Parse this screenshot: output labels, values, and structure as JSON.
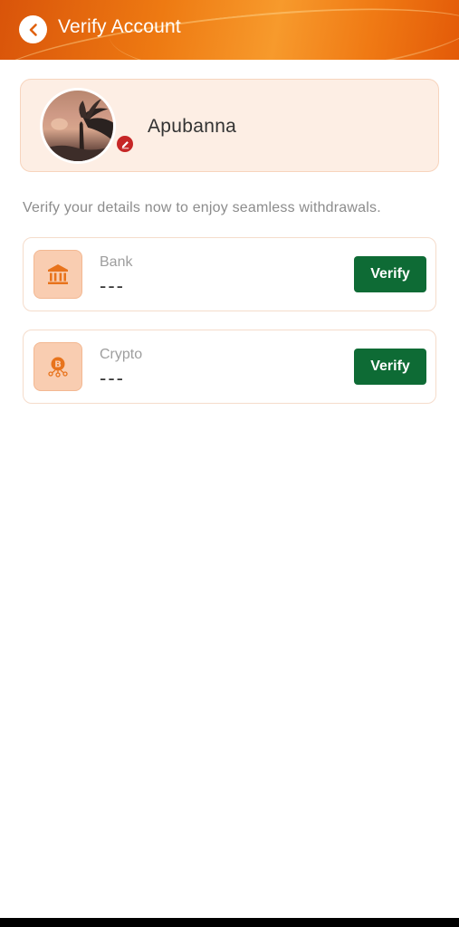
{
  "header": {
    "title": "Verify Account",
    "back_icon": "chevron-left-icon",
    "colors": {
      "gradient_start": "#d9540a",
      "gradient_mid": "#f79a2c",
      "gradient_end": "#e35a08"
    }
  },
  "profile": {
    "username": "Apubanna",
    "edit_icon": "pencil-icon",
    "edit_badge_color": "#c62626"
  },
  "info": {
    "text": "Verify your details now to enjoy seamless withdrawals."
  },
  "methods": [
    {
      "label": "Bank",
      "value": "---",
      "icon": "bank-icon",
      "button_label": "Verify"
    },
    {
      "label": "Crypto",
      "value": "---",
      "icon": "bitcoin-icon",
      "button_label": "Verify"
    }
  ],
  "colors": {
    "verify_button": "#0e6b35",
    "card_background": "#fdeee4",
    "icon_tile": "#f9cdb1",
    "icon_glyph": "#e8731c"
  }
}
